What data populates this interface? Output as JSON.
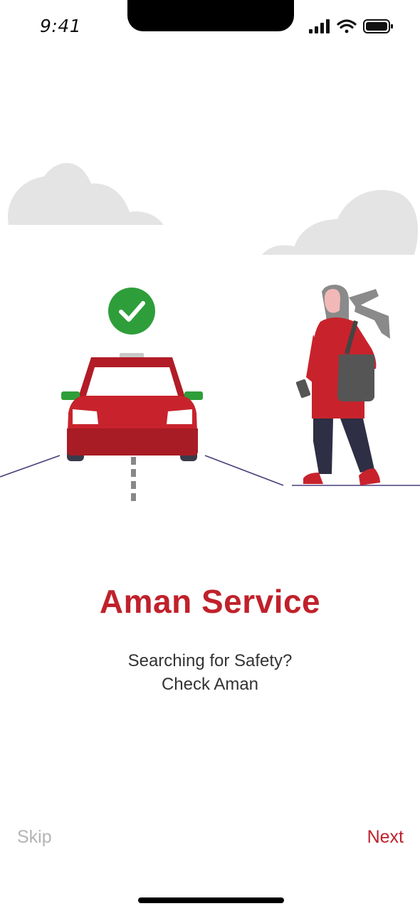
{
  "status_bar": {
    "time": "9:41",
    "icons": [
      "cellular-signal-icon",
      "wifi-icon",
      "battery-icon"
    ]
  },
  "onboarding": {
    "title": "Aman Service",
    "subtitle_line1": "Searching for Safety?",
    "subtitle_line2": "Check Aman",
    "illustration": [
      "cloud-icon",
      "taxi-car-icon",
      "check-badge-icon",
      "woman-walking-figure"
    ]
  },
  "footer": {
    "skip_label": "Skip",
    "next_label": "Next"
  },
  "colors": {
    "brand_red": "#c0212b",
    "check_green": "#2e9e3a",
    "skip_gray": "#b4b4b4",
    "cloud_gray": "#e4e4e4"
  }
}
